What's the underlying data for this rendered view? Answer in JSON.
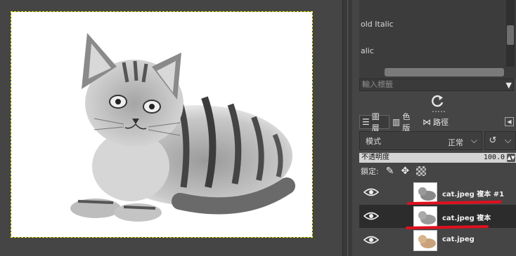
{
  "font_list": {
    "items": [
      "old Italic",
      "alic"
    ]
  },
  "tag_input": {
    "placeholder": "輸入標籤"
  },
  "tabs": [
    {
      "label": "圖層",
      "icon": "layers-icon"
    },
    {
      "label": "色版",
      "icon": "channels-icon"
    },
    {
      "label": "路徑",
      "icon": "paths-icon"
    }
  ],
  "mode": {
    "label": "模式",
    "value": "正常"
  },
  "opacity": {
    "label": "不透明度",
    "value": "100.0"
  },
  "lock": {
    "label": "鎖定:"
  },
  "layers": [
    {
      "name": "cat.jpeg 複本 #1",
      "visible": true,
      "style": "grayscale"
    },
    {
      "name": "cat.jpeg 複本",
      "visible": true,
      "style": "grayscale",
      "selected": true
    },
    {
      "name": "cat.jpeg",
      "visible": true,
      "style": "color"
    }
  ],
  "colors": {
    "selection_outline": "#e8e800",
    "annotation_underline": "#e0101e"
  }
}
